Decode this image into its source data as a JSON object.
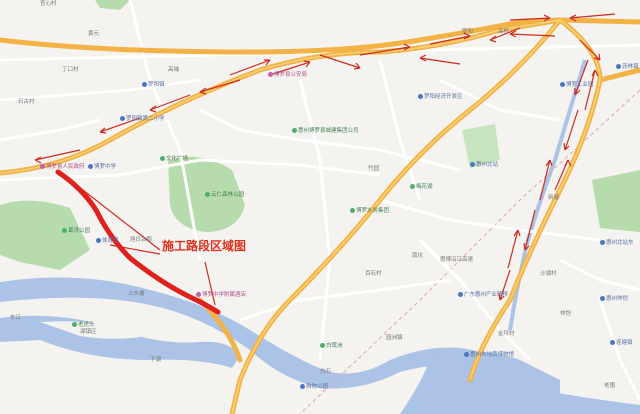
{
  "callout": {
    "text": "施工路段区域图"
  },
  "colors": {
    "highway": "#f2b245",
    "road": "#ffffff",
    "river": "#aac3e6",
    "park": "#b6dcae",
    "highlight": "#e0201c",
    "arrow": "#d02a20"
  },
  "labels": [
    {
      "text": "官心村",
      "type": "plain"
    },
    {
      "text": "黄元",
      "type": "plain"
    },
    {
      "text": "丁口村",
      "type": "plain"
    },
    {
      "text": "高埔",
      "type": "plain"
    },
    {
      "text": "石古村",
      "type": "plain"
    },
    {
      "text": "博罗县公安局",
      "type": "pink"
    },
    {
      "text": "罗阳镇",
      "type": "blue"
    },
    {
      "text": "博罗县人民政府",
      "type": "pink"
    },
    {
      "text": "博罗中学",
      "type": "blue"
    },
    {
      "text": "罗阳镇第二小学",
      "type": "blue"
    },
    {
      "text": "文化广场",
      "type": "poi"
    },
    {
      "text": "云仁森林公园",
      "type": "poi"
    },
    {
      "text": "旭日古郡",
      "type": "plain"
    },
    {
      "text": "葛洪公园",
      "type": "poi"
    },
    {
      "text": "体育馆",
      "type": "blue"
    },
    {
      "text": "东江",
      "type": "plain"
    },
    {
      "text": "上头塘",
      "type": "plain"
    },
    {
      "text": "下湖",
      "type": "plain"
    },
    {
      "text": "博罗中学附属酒店",
      "type": "pink"
    },
    {
      "text": "老虎头",
      "type": "poi"
    },
    {
      "text": "湖镇区",
      "type": "plain"
    },
    {
      "text": "购物公园",
      "type": "blue"
    },
    {
      "text": "竹园",
      "type": "plain"
    },
    {
      "text": "惠州博罗县城建集团公司",
      "type": "poi"
    },
    {
      "text": "罗阳经济开发区",
      "type": "blue"
    },
    {
      "text": "博罗水务集团",
      "type": "poi"
    },
    {
      "text": "百石村",
      "type": "plain"
    },
    {
      "text": "白石",
      "type": "plain"
    },
    {
      "text": "园洲镇",
      "type": "plain"
    },
    {
      "text": "广东惠州产业转移",
      "type": "blue"
    },
    {
      "text": "白鹭洲",
      "type": "poi"
    },
    {
      "text": "惠州北站",
      "type": "blue"
    },
    {
      "text": "金坪村",
      "type": "plain"
    },
    {
      "text": "惠州市地质博物馆",
      "type": "blue"
    },
    {
      "text": "惠州北站东",
      "type": "blue"
    },
    {
      "text": "惠博沿江高速",
      "type": "plain"
    },
    {
      "text": "沙湖村",
      "type": "plain"
    },
    {
      "text": "新塘",
      "type": "plain"
    },
    {
      "text": "高桥",
      "type": "plain"
    },
    {
      "text": "罗阳",
      "type": "plain"
    },
    {
      "text": "沥林镇",
      "type": "blue"
    },
    {
      "text": "博罗工业园",
      "type": "blue"
    },
    {
      "text": "梅花湖",
      "type": "poi"
    },
    {
      "text": "南坑",
      "type": "plain"
    },
    {
      "text": "惠州仲恺",
      "type": "blue"
    },
    {
      "text": "连塘镇",
      "type": "blue"
    },
    {
      "text": "老围",
      "type": "plain"
    },
    {
      "text": "仲恺",
      "type": "plain"
    }
  ]
}
